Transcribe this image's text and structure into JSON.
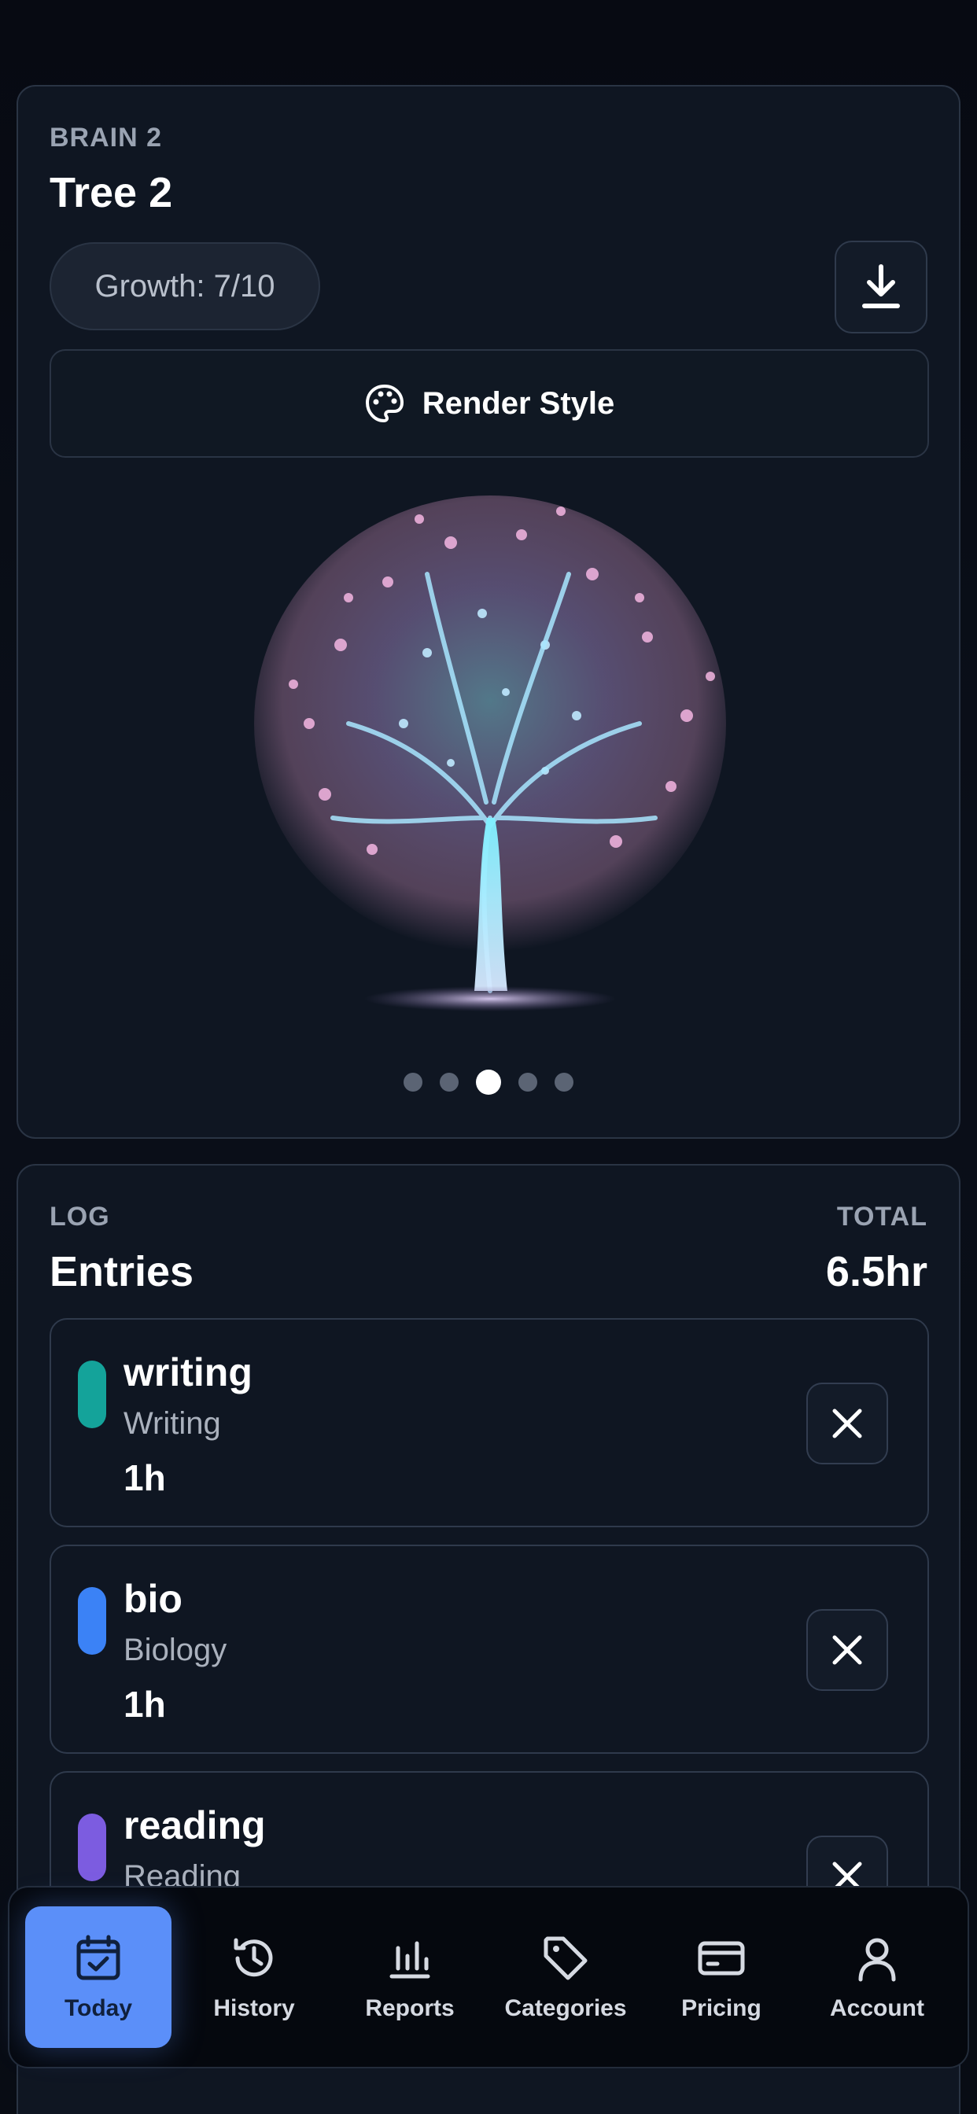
{
  "tree_card": {
    "eyebrow": "BRAIN 2",
    "title": "Tree 2",
    "growth": "Growth: 7/10",
    "render_style_label": "Render Style",
    "carousel": {
      "count": 5,
      "active_index": 3
    }
  },
  "log_card": {
    "eyebrow": "LOG",
    "title": "Entries",
    "total_label": "TOTAL",
    "total_value": "6.5hr",
    "entries": [
      {
        "name": "writing",
        "category": "Writing",
        "hours": "1h",
        "color": "#14a39a"
      },
      {
        "name": "bio",
        "category": "Biology",
        "hours": "1h",
        "color": "#3b82f6"
      },
      {
        "name": "reading",
        "category": "Reading",
        "hours": "",
        "color": "#7c5ce0"
      }
    ]
  },
  "tabbar": {
    "tabs": [
      {
        "label": "Today",
        "icon": "calendar-check-icon",
        "active": true
      },
      {
        "label": "History",
        "icon": "history-icon",
        "active": false
      },
      {
        "label": "Reports",
        "icon": "bar-chart-icon",
        "active": false
      },
      {
        "label": "Categories",
        "icon": "tag-icon",
        "active": false
      },
      {
        "label": "Pricing",
        "icon": "credit-card-icon",
        "active": false
      },
      {
        "label": "Account",
        "icon": "user-icon",
        "active": false
      }
    ]
  },
  "colors": {
    "accent": "#5b8ff9",
    "card_bg": "#0f1622",
    "border": "#2a3444"
  }
}
